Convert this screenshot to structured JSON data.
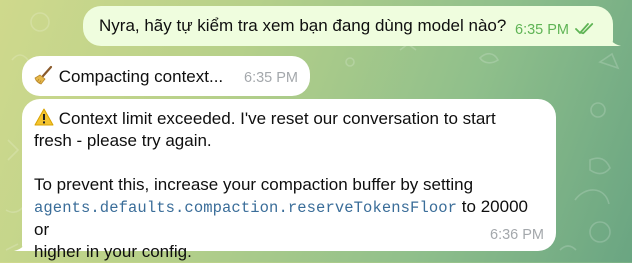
{
  "messages": [
    {
      "id": "user-question",
      "text": "Nyra, hãy tự kiểm tra xem bạn đang dùng model nào?",
      "time": "6:35 PM",
      "status": "read-double-check"
    },
    {
      "id": "compacting-status",
      "icon": "broom-icon",
      "text": "Compacting context...",
      "time": "6:35 PM"
    },
    {
      "id": "context-limit-warning",
      "icon": "warning-icon",
      "line1": "Context limit exceeded. I've reset our conversation to start",
      "line2": "fresh - please try again.",
      "para2_text1": "To prevent this, increase your compaction buffer by setting",
      "config_key": "agents.defaults.compaction.reserveTokensFloor",
      "para2_text2": " to 20000 or",
      "para2_text3": "higher in your config.",
      "time": "6:36 PM"
    }
  ],
  "colors": {
    "incoming_bubble": "#ffffff",
    "outgoing_bubble": "#effdde",
    "outgoing_time": "#5fb455",
    "incoming_time": "#a4a8ac",
    "code": "#3a6d99"
  }
}
